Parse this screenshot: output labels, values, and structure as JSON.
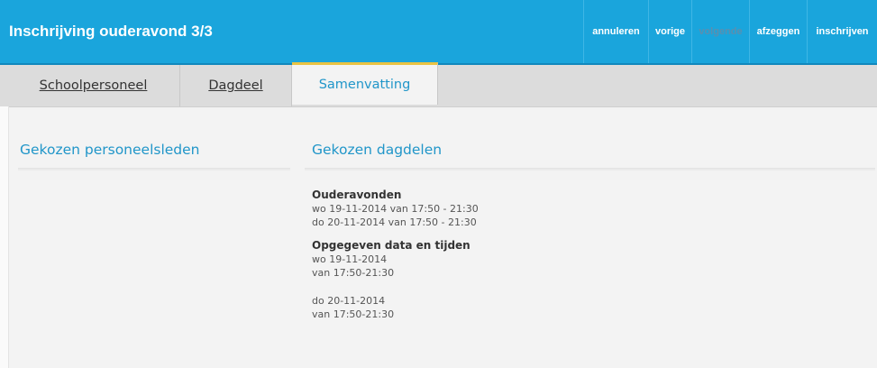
{
  "header": {
    "title": "Inschrijving ouderavond 3/3"
  },
  "toolbar": {
    "buttons": [
      {
        "label": "annuleren",
        "enabled": true
      },
      {
        "label": "vorige",
        "enabled": true
      },
      {
        "label": "volgende",
        "enabled": false
      },
      {
        "label": "afzeggen",
        "enabled": true
      },
      {
        "label": "inschrijven",
        "enabled": true
      }
    ]
  },
  "tabs": [
    {
      "label": "Schoolpersoneel",
      "active": false
    },
    {
      "label": "Dagdeel",
      "active": false
    },
    {
      "label": "Samenvatting",
      "active": true
    }
  ],
  "main": {
    "left_heading": "Gekozen personeelsleden",
    "right_heading": "Gekozen dagdelen",
    "ouderavonden": {
      "title": "Ouderavonden",
      "lines": [
        "wo 19-11-2014 van 17:50 - 21:30",
        "do 20-11-2014 van 17:50 - 21:30"
      ]
    },
    "opgegeven": {
      "title": "Opgegeven data en tijden",
      "entries": [
        {
          "date": "wo 19-11-2014",
          "time": "van 17:50-21:30"
        },
        {
          "date": "do 20-11-2014",
          "time": "van 17:50-21:30"
        }
      ]
    }
  },
  "colors": {
    "header_bg": "#1aa5dc",
    "accent_text": "#2196c9",
    "active_tab_border": "#e9c243"
  }
}
